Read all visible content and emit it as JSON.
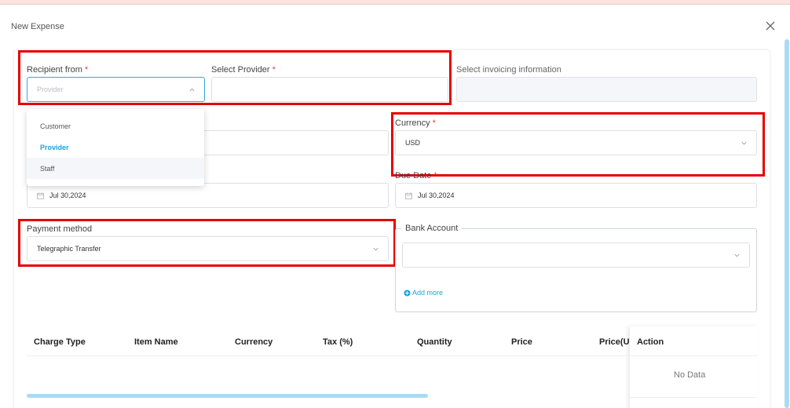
{
  "modal": {
    "title": "New Expense"
  },
  "form": {
    "recipient_from": {
      "label": "Recipient from",
      "required": "*",
      "placeholder": "Provider"
    },
    "select_provider": {
      "label": "Select Provider",
      "required": "*",
      "value": ""
    },
    "invoicing_info": {
      "label": "Select invoicing information"
    },
    "recipient_options": [
      "Customer",
      "Provider",
      "Staff"
    ],
    "currency": {
      "label": "Currency",
      "required": "*",
      "value": "USD"
    },
    "date": {
      "value": "Jul 30,2024"
    },
    "due_date": {
      "label": "Due Date",
      "required": "*",
      "value": "Jul 30,2024"
    },
    "payment_method": {
      "label": "Payment method",
      "value": "Telegraphic Transfer"
    },
    "bank_account": {
      "label": "Bank Account",
      "value": "",
      "add_more": "Add more"
    }
  },
  "table": {
    "columns": [
      "Charge Type",
      "Item Name",
      "Currency",
      "Tax (%)",
      "Quantity",
      "Price",
      "Price(U",
      "Action"
    ],
    "empty_text": "No Data"
  },
  "colors": {
    "accent": "#1aa3e0",
    "highlight_box": "#e50000",
    "required": "#e0453a"
  }
}
